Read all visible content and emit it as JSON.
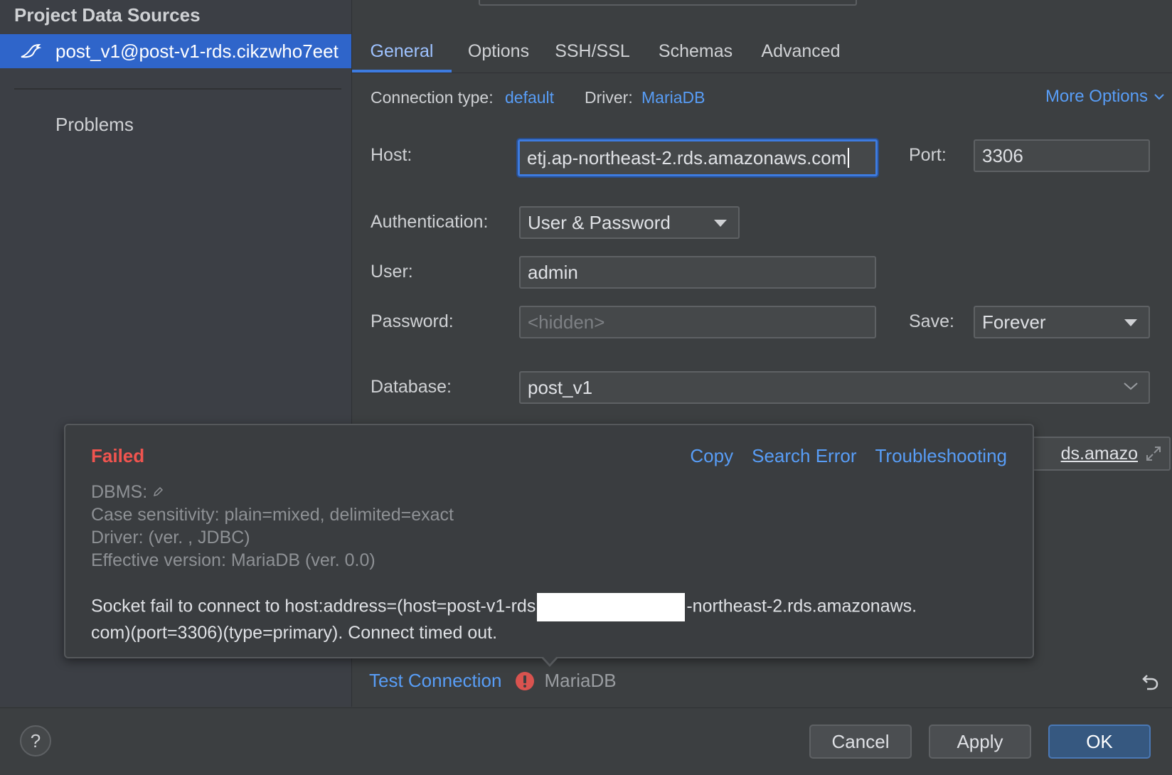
{
  "sidebar": {
    "title": "Project Data Sources",
    "data_source": "post_v1@post-v1-rds.cikzwho7eet",
    "problems": "Problems"
  },
  "tabs": [
    "General",
    "Options",
    "SSH/SSL",
    "Schemas",
    "Advanced"
  ],
  "general": {
    "connection_type_label": "Connection type:",
    "connection_type_value": "default",
    "driver_label": "Driver:",
    "driver_value": "MariaDB",
    "more_options": "More Options",
    "host_label": "Host:",
    "host_value": "etj.ap-northeast-2.rds.amazonaws.com",
    "port_label": "Port:",
    "port_value": "3306",
    "auth_label": "Authentication:",
    "auth_value": "User & Password",
    "user_label": "User:",
    "user_value": "admin",
    "password_label": "Password:",
    "password_placeholder": "<hidden>",
    "save_label": "Save:",
    "save_value": "Forever",
    "database_label": "Database:",
    "database_value": "post_v1",
    "url_fragment": "ds.amazo"
  },
  "popup": {
    "status": "Failed",
    "actions": [
      "Copy",
      "Search Error",
      "Troubleshooting"
    ],
    "info": {
      "dbms": "DBMS:",
      "case_sensitivity": "Case sensitivity: plain=mixed, delimited=exact",
      "driver": "Driver: (ver. , JDBC)",
      "effective_version": "Effective version: MariaDB (ver. 0.0)"
    },
    "message_part1": "Socket fail to connect to host:address=(host=post-v1-rds",
    "message_part2": "-northeast-2.rds.amazonaws.",
    "message_part3": "com)(port=3306)(type=primary). Connect timed out."
  },
  "test": {
    "link": "Test Connection",
    "driver": "MariaDB"
  },
  "footer": {
    "help": "?",
    "cancel": "Cancel",
    "apply": "Apply",
    "ok": "OK"
  },
  "colors": {
    "accent": "#3d7be0",
    "link": "#589df6",
    "error": "#f0544f",
    "selection": "#2f65ca"
  }
}
